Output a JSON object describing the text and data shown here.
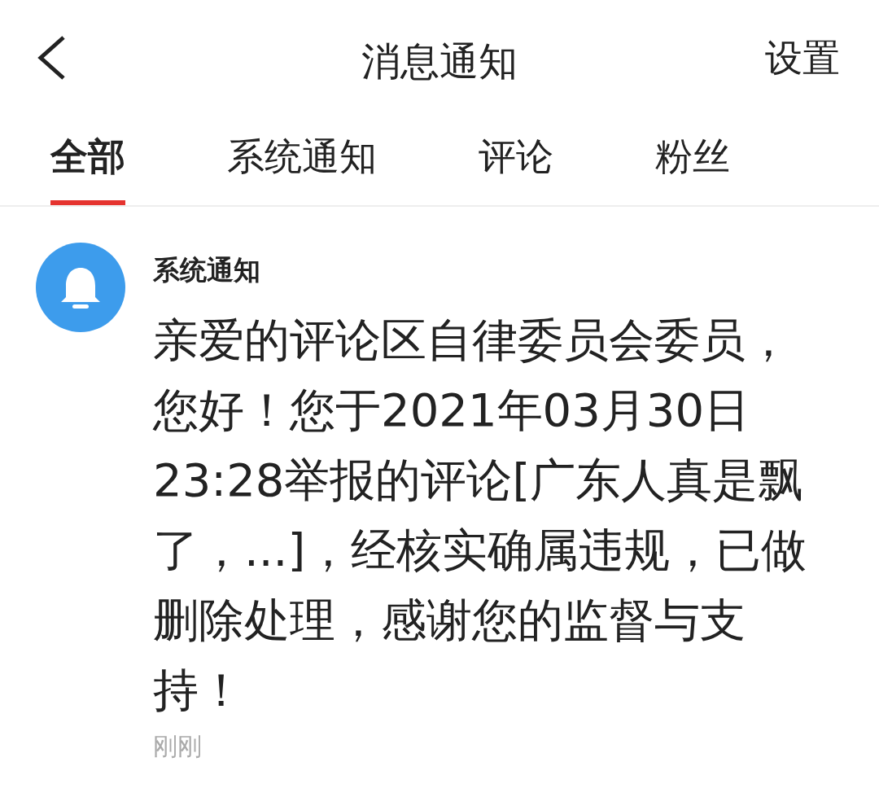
{
  "header": {
    "title": "消息通知",
    "action": "设置"
  },
  "tabs": [
    {
      "label": "全部",
      "selected": true
    },
    {
      "label": "系统通知",
      "selected": false
    },
    {
      "label": "评论",
      "selected": false
    },
    {
      "label": "粉丝",
      "selected": false
    }
  ],
  "messages": [
    {
      "sender": "系统通知",
      "body": "亲爱的评论区自律委员会委员，您好！您于2021年03月30日23:28举报的评论[广东人真是飘了，...]，经核实确属违规，已做删除处理，感谢您的监督与支持！",
      "time": "刚刚"
    }
  ]
}
